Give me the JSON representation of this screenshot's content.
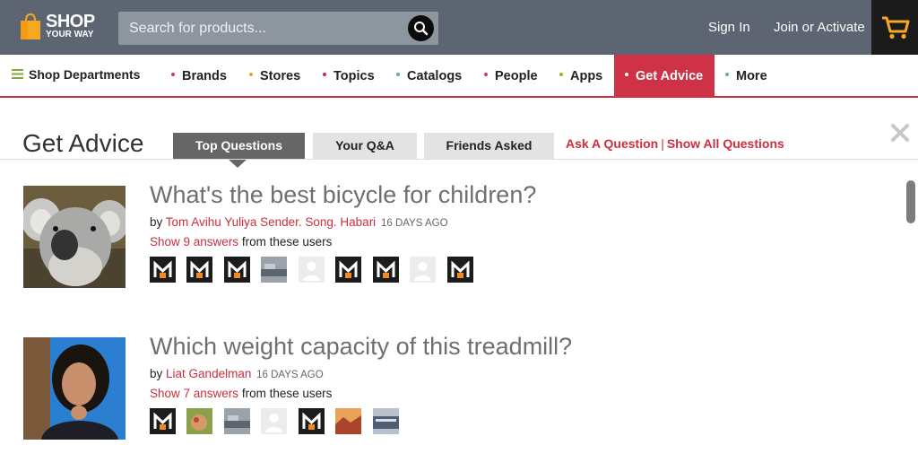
{
  "header": {
    "logo_text": "SHOP",
    "logo_subtext": "YOUR WAY",
    "search_placeholder": "Search for products...",
    "sign_in": "Sign In",
    "join": "Join or Activate"
  },
  "nav": {
    "shop_departments": "Shop Departments",
    "items": [
      {
        "label": "Brands",
        "dot_color": "#d23b59"
      },
      {
        "label": "Stores",
        "dot_color": "#e8a33d"
      },
      {
        "label": "Topics",
        "dot_color": "#cc2f3f"
      },
      {
        "label": "Catalogs",
        "dot_color": "#5ab2b0"
      },
      {
        "label": "People",
        "dot_color": "#d23b59"
      },
      {
        "label": "Apps",
        "dot_color": "#9bb032"
      },
      {
        "label": "Get Advice",
        "dot_color": "#ffffff",
        "active": true
      },
      {
        "label": "More",
        "dot_color": "#5ab2b0"
      }
    ]
  },
  "page": {
    "title": "Get Advice",
    "tabs": [
      {
        "label": "Top Questions",
        "active": true
      },
      {
        "label": "Your Q&A"
      },
      {
        "label": "Friends Asked"
      }
    ],
    "ask_question": "Ask A Question",
    "separator": "|",
    "show_all": "Show All Questions"
  },
  "questions": [
    {
      "title": "What's the best bicycle for children?",
      "by_label": "by",
      "author": "Tom Avihu Yuliya Sender. Song. Habari",
      "ago": "16 days ago",
      "show_answers": "Show 9 answers",
      "from_users": "from these users",
      "photo_icon": "koala-photo",
      "avatars": [
        "m-logo",
        "m-logo",
        "m-logo",
        "desk-photo",
        "blank-user",
        "m-logo",
        "m-logo",
        "blank-user",
        "m-logo"
      ]
    },
    {
      "title": "Which weight capacity of this treadmill?",
      "by_label": "by",
      "author": "Liat Gandelman",
      "ago": "16 days ago",
      "show_answers": "Show 7 answers",
      "from_users": "from these users",
      "photo_icon": "woman-portrait-photo",
      "avatars": [
        "m-logo",
        "food-photo",
        "desk-photo",
        "blank-user",
        "m-logo",
        "landscape-photo",
        "building-photo"
      ]
    }
  ],
  "colors": {
    "header_bg": "#5c6571",
    "accent_red": "#cc2f3f",
    "active_tab_bg": "#666666",
    "tab_bg": "#e3e3e3"
  }
}
